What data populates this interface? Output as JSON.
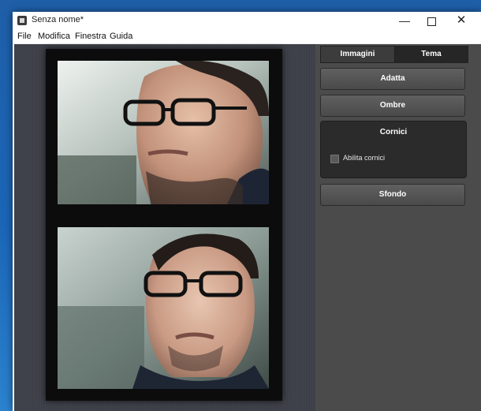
{
  "window": {
    "title": "Senza nome*",
    "controls": {
      "minimize": "—",
      "close": "✕"
    }
  },
  "menu": [
    "File",
    "Modifica",
    "Finestra",
    "Guida"
  ],
  "panel": {
    "tabs": [
      {
        "label": "Immagini",
        "active": false
      },
      {
        "label": "Tema",
        "active": true
      }
    ],
    "buttons": {
      "adatta": "Adatta",
      "ombre": "Ombre",
      "sfondo": "Sfondo"
    },
    "cornici": {
      "title": "Cornici",
      "checkbox_label": "Abilita cornici",
      "checked": false
    }
  },
  "colors": {
    "panel_bg": "#4b4b4b",
    "workarea_bg": "#3d4048",
    "accent": "#ffffff"
  }
}
